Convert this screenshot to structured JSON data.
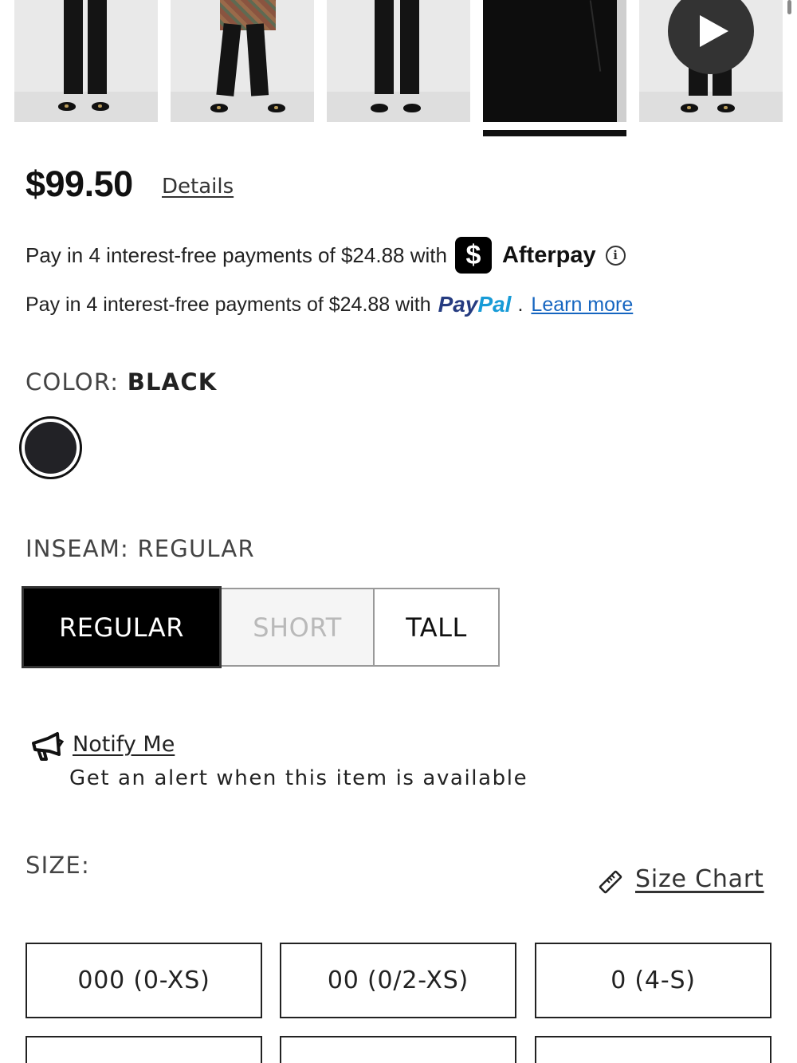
{
  "gallery": {
    "thumbnails": [
      "product-front",
      "product-styled",
      "product-back",
      "product-closeup",
      "product-video"
    ],
    "active_index": 3,
    "play_icon": "play-icon"
  },
  "price": {
    "amount": "$99.50",
    "details_label": "Details"
  },
  "payments": {
    "afterpay_text": "Pay in 4 interest-free payments of $24.88 with",
    "afterpay_badge": "$",
    "afterpay_name": "Afterpay",
    "afterpay_info_icon": "info-icon",
    "paypal_text": "Pay in 4 interest-free payments of $24.88 with",
    "paypal_part1": "Pay",
    "paypal_part2": "Pal",
    "paypal_dot": ".",
    "learn_more": "Learn more",
    "paypal_colors": [
      "#253b80",
      "#179bd7"
    ],
    "learn_more_color": "#1565c0"
  },
  "color": {
    "label": "COLOR:",
    "value": "BLACK",
    "swatches": [
      {
        "name": "Black",
        "hex": "#222226",
        "selected": true
      }
    ]
  },
  "inseam": {
    "label": "INSEAM:",
    "value": "REGULAR",
    "options": [
      {
        "label": "REGULAR",
        "state": "selected"
      },
      {
        "label": "SHORT",
        "state": "disabled"
      },
      {
        "label": "TALL",
        "state": "available"
      }
    ]
  },
  "notify": {
    "link": "Notify Me",
    "text": "Get an alert when this item is available",
    "icon": "megaphone-icon"
  },
  "size": {
    "label": "SIZE:",
    "chart_label": "Size Chart",
    "chart_icon": "ruler-icon",
    "options": [
      "000 (0-XS)",
      "00 (0/2-XS)",
      "0 (4-S)",
      "",
      "",
      ""
    ]
  }
}
